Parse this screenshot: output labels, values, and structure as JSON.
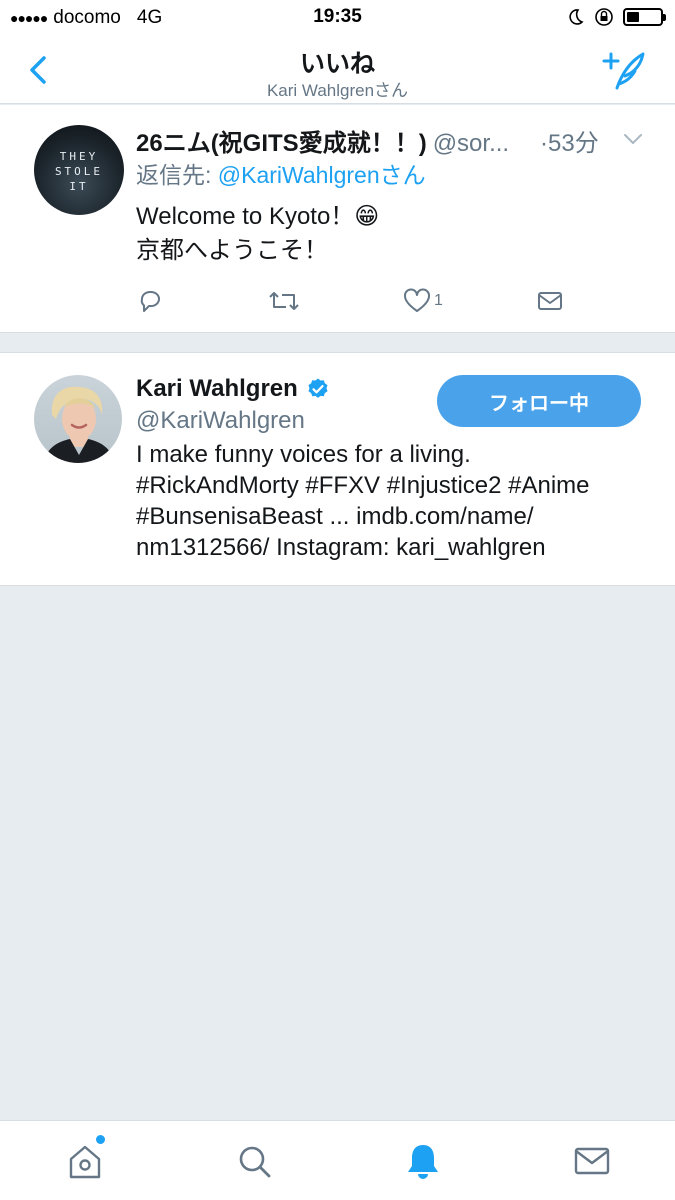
{
  "status_bar": {
    "carrier": "docomo",
    "network": "4G",
    "time": "19:35"
  },
  "header": {
    "title": "いいね",
    "subtitle": "Kari Wahlgrenさん"
  },
  "tweet": {
    "display_name": "26ニム(祝GITS愛成就！！)",
    "handle": "@sor...",
    "time": "·53分",
    "reply_label": "返信先:",
    "reply_to": "@KariWahlgrenさん",
    "text_line1": "Welcome to Kyoto！😁",
    "text_line2": "京都へようこそ！",
    "like_count": "1",
    "avatar_text": [
      "THEY",
      "STOLE",
      "IT"
    ]
  },
  "profile": {
    "display_name": "Kari Wahlgren",
    "handle": "@KariWahlgren",
    "follow_label": "フォロー中",
    "bio_line1": "I make funny voices for a living.",
    "bio_line2": "#RickAndMorty #FFXV #Injustice2 #Anime",
    "bio_line3": "#BunsenisaBeast ... imdb.com/name/",
    "bio_line4": "nm1312566/ Instagram: kari_wahlgren"
  },
  "tabs": [
    {
      "icon": "home-icon"
    },
    {
      "icon": "search-icon"
    },
    {
      "icon": "notifications-icon"
    },
    {
      "icon": "messages-icon"
    }
  ],
  "colors": {
    "accent": "#1da1f2",
    "muted": "#657786",
    "background": "#e6ecf0",
    "follow_button": "#4aa3ea"
  }
}
